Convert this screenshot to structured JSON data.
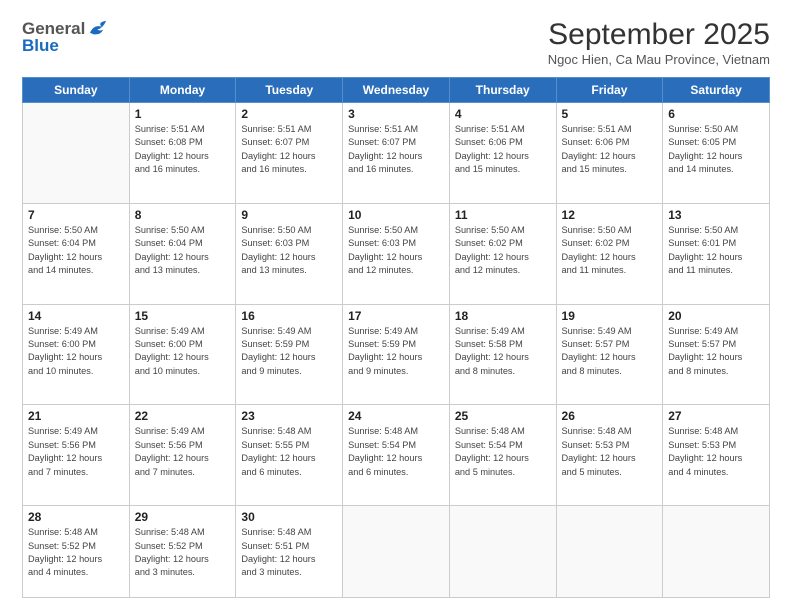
{
  "header": {
    "logo_general": "General",
    "logo_blue": "Blue",
    "month_title": "September 2025",
    "subtitle": "Ngoc Hien, Ca Mau Province, Vietnam"
  },
  "days_of_week": [
    "Sunday",
    "Monday",
    "Tuesday",
    "Wednesday",
    "Thursday",
    "Friday",
    "Saturday"
  ],
  "weeks": [
    [
      {
        "day": "",
        "info": ""
      },
      {
        "day": "1",
        "info": "Sunrise: 5:51 AM\nSunset: 6:08 PM\nDaylight: 12 hours\nand 16 minutes."
      },
      {
        "day": "2",
        "info": "Sunrise: 5:51 AM\nSunset: 6:07 PM\nDaylight: 12 hours\nand 16 minutes."
      },
      {
        "day": "3",
        "info": "Sunrise: 5:51 AM\nSunset: 6:07 PM\nDaylight: 12 hours\nand 16 minutes."
      },
      {
        "day": "4",
        "info": "Sunrise: 5:51 AM\nSunset: 6:06 PM\nDaylight: 12 hours\nand 15 minutes."
      },
      {
        "day": "5",
        "info": "Sunrise: 5:51 AM\nSunset: 6:06 PM\nDaylight: 12 hours\nand 15 minutes."
      },
      {
        "day": "6",
        "info": "Sunrise: 5:50 AM\nSunset: 6:05 PM\nDaylight: 12 hours\nand 14 minutes."
      }
    ],
    [
      {
        "day": "7",
        "info": "Sunrise: 5:50 AM\nSunset: 6:04 PM\nDaylight: 12 hours\nand 14 minutes."
      },
      {
        "day": "8",
        "info": "Sunrise: 5:50 AM\nSunset: 6:04 PM\nDaylight: 12 hours\nand 13 minutes."
      },
      {
        "day": "9",
        "info": "Sunrise: 5:50 AM\nSunset: 6:03 PM\nDaylight: 12 hours\nand 13 minutes."
      },
      {
        "day": "10",
        "info": "Sunrise: 5:50 AM\nSunset: 6:03 PM\nDaylight: 12 hours\nand 12 minutes."
      },
      {
        "day": "11",
        "info": "Sunrise: 5:50 AM\nSunset: 6:02 PM\nDaylight: 12 hours\nand 12 minutes."
      },
      {
        "day": "12",
        "info": "Sunrise: 5:50 AM\nSunset: 6:02 PM\nDaylight: 12 hours\nand 11 minutes."
      },
      {
        "day": "13",
        "info": "Sunrise: 5:50 AM\nSunset: 6:01 PM\nDaylight: 12 hours\nand 11 minutes."
      }
    ],
    [
      {
        "day": "14",
        "info": "Sunrise: 5:49 AM\nSunset: 6:00 PM\nDaylight: 12 hours\nand 10 minutes."
      },
      {
        "day": "15",
        "info": "Sunrise: 5:49 AM\nSunset: 6:00 PM\nDaylight: 12 hours\nand 10 minutes."
      },
      {
        "day": "16",
        "info": "Sunrise: 5:49 AM\nSunset: 5:59 PM\nDaylight: 12 hours\nand 9 minutes."
      },
      {
        "day": "17",
        "info": "Sunrise: 5:49 AM\nSunset: 5:59 PM\nDaylight: 12 hours\nand 9 minutes."
      },
      {
        "day": "18",
        "info": "Sunrise: 5:49 AM\nSunset: 5:58 PM\nDaylight: 12 hours\nand 8 minutes."
      },
      {
        "day": "19",
        "info": "Sunrise: 5:49 AM\nSunset: 5:57 PM\nDaylight: 12 hours\nand 8 minutes."
      },
      {
        "day": "20",
        "info": "Sunrise: 5:49 AM\nSunset: 5:57 PM\nDaylight: 12 hours\nand 8 minutes."
      }
    ],
    [
      {
        "day": "21",
        "info": "Sunrise: 5:49 AM\nSunset: 5:56 PM\nDaylight: 12 hours\nand 7 minutes."
      },
      {
        "day": "22",
        "info": "Sunrise: 5:49 AM\nSunset: 5:56 PM\nDaylight: 12 hours\nand 7 minutes."
      },
      {
        "day": "23",
        "info": "Sunrise: 5:48 AM\nSunset: 5:55 PM\nDaylight: 12 hours\nand 6 minutes."
      },
      {
        "day": "24",
        "info": "Sunrise: 5:48 AM\nSunset: 5:54 PM\nDaylight: 12 hours\nand 6 minutes."
      },
      {
        "day": "25",
        "info": "Sunrise: 5:48 AM\nSunset: 5:54 PM\nDaylight: 12 hours\nand 5 minutes."
      },
      {
        "day": "26",
        "info": "Sunrise: 5:48 AM\nSunset: 5:53 PM\nDaylight: 12 hours\nand 5 minutes."
      },
      {
        "day": "27",
        "info": "Sunrise: 5:48 AM\nSunset: 5:53 PM\nDaylight: 12 hours\nand 4 minutes."
      }
    ],
    [
      {
        "day": "28",
        "info": "Sunrise: 5:48 AM\nSunset: 5:52 PM\nDaylight: 12 hours\nand 4 minutes."
      },
      {
        "day": "29",
        "info": "Sunrise: 5:48 AM\nSunset: 5:52 PM\nDaylight: 12 hours\nand 3 minutes."
      },
      {
        "day": "30",
        "info": "Sunrise: 5:48 AM\nSunset: 5:51 PM\nDaylight: 12 hours\nand 3 minutes."
      },
      {
        "day": "",
        "info": ""
      },
      {
        "day": "",
        "info": ""
      },
      {
        "day": "",
        "info": ""
      },
      {
        "day": "",
        "info": ""
      }
    ]
  ]
}
